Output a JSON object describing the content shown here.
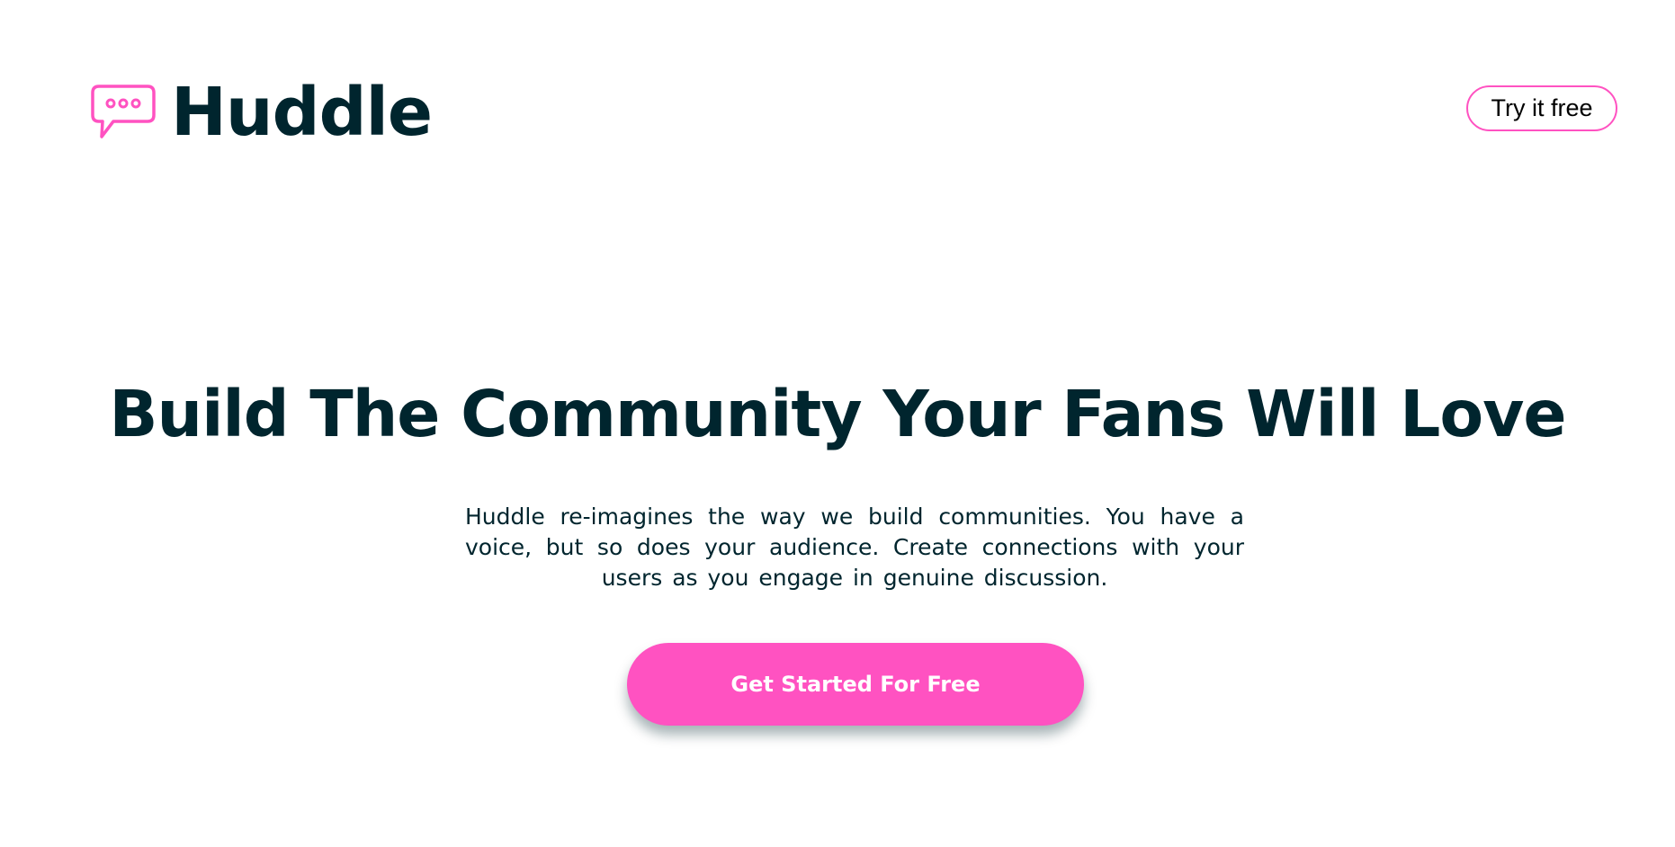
{
  "brand": {
    "name": "Huddle",
    "icon": "chat-bubble-icon",
    "accent_color": "#ff52c1",
    "text_color": "#00252e"
  },
  "header": {
    "try_label": "Try it free"
  },
  "hero": {
    "headline": "Build The Community Your Fans Will Love",
    "description": "Huddle re-imagines the way we build communities. You have a voice, but so does your audience. Create connections with your users as you engage in genuine discussion.",
    "cta_label": "Get Started For Free"
  }
}
